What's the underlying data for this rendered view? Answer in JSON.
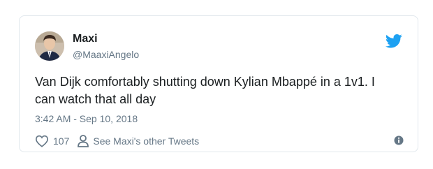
{
  "tweet": {
    "author_name": "Maxi",
    "author_handle": "@MaaxiAngelo",
    "text": "Van Dijk comfortably shutting down Kylian Mbappé in a 1v1. I can watch that all day",
    "timestamp": "3:42 AM - Sep 10, 2018",
    "like_count": "107",
    "other_tweets_label": "See Maxi's other Tweets"
  },
  "icons": {
    "brand": "twitter-bird-icon",
    "like": "heart-icon",
    "profile": "person-icon",
    "info": "info-icon"
  },
  "colors": {
    "twitter_blue": "#1da1f2",
    "text": "#1c2022",
    "muted": "#657786",
    "border": "#e1e8ed"
  }
}
